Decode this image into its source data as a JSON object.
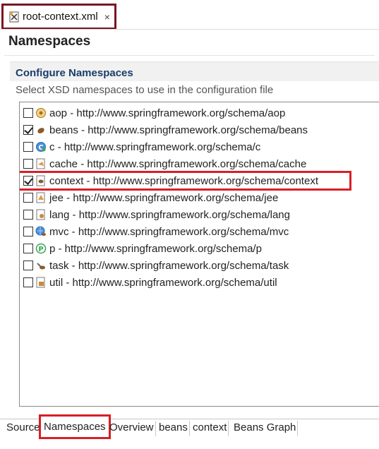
{
  "editor_tab": {
    "title": "root-context.xml",
    "close": "×"
  },
  "page_title": "Namespaces",
  "section": {
    "header": "Configure Namespaces",
    "description": "Select XSD namespaces to use in the configuration file"
  },
  "namespaces": [
    {
      "label": "aop - http://www.springframework.org/schema/aop",
      "checked": false,
      "icon": "aop-icon"
    },
    {
      "label": "beans - http://www.springframework.org/schema/beans",
      "checked": true,
      "icon": "bean-icon"
    },
    {
      "label": "c - http://www.springframework.org/schema/c",
      "checked": false,
      "icon": "c-namespace-icon"
    },
    {
      "label": "cache - http://www.springframework.org/schema/cache",
      "checked": false,
      "icon": "cache-icon"
    },
    {
      "label": "context - http://www.springframework.org/schema/context",
      "checked": true,
      "icon": "context-icon"
    },
    {
      "label": "jee - http://www.springframework.org/schema/jee",
      "checked": false,
      "icon": "jee-icon"
    },
    {
      "label": "lang - http://www.springframework.org/schema/lang",
      "checked": false,
      "icon": "lang-icon"
    },
    {
      "label": "mvc - http://www.springframework.org/schema/mvc",
      "checked": false,
      "icon": "mvc-icon"
    },
    {
      "label": "p - http://www.springframework.org/schema/p",
      "checked": false,
      "icon": "p-namespace-icon"
    },
    {
      "label": "task - http://www.springframework.org/schema/task",
      "checked": false,
      "icon": "task-icon"
    },
    {
      "label": "util - http://www.springframework.org/schema/util",
      "checked": false,
      "icon": "util-icon"
    }
  ],
  "bottom_tabs": [
    "Source",
    "Namespaces",
    "Overview",
    "beans",
    "context",
    "Beans Graph"
  ],
  "active_bottom_tab": "Namespaces",
  "colors": {
    "highlight": "#d91f26",
    "tab_border": "#7a1422",
    "section_header_text": "#1a3d6b"
  }
}
